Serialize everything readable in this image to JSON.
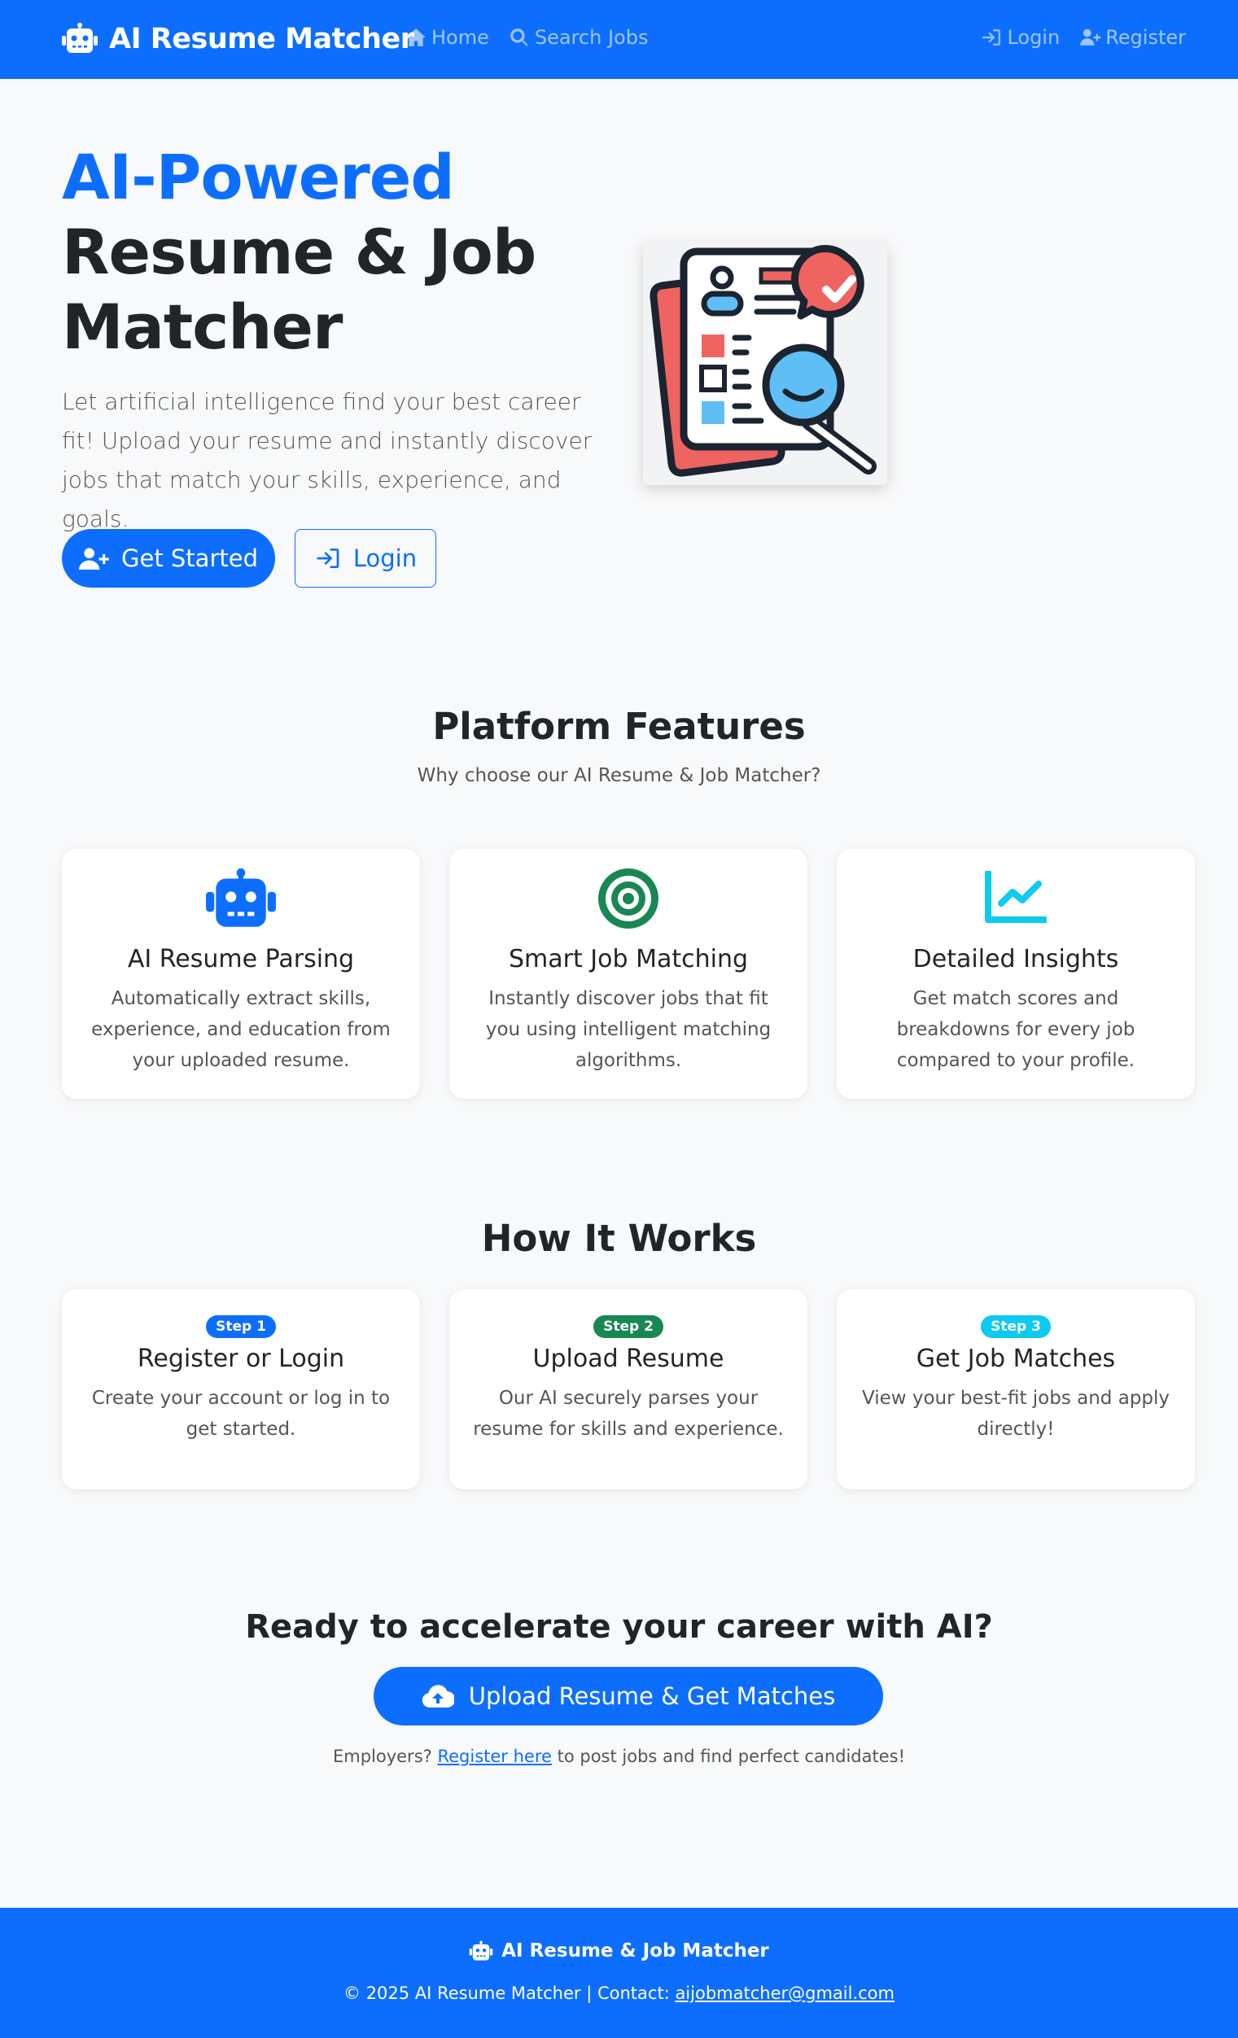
{
  "navbar": {
    "brand": "AI Resume Matcher",
    "links_left": [
      {
        "label": "Home",
        "icon": "home-icon"
      },
      {
        "label": "Search Jobs",
        "icon": "search-icon"
      }
    ],
    "links_right": [
      {
        "label": "Login",
        "icon": "login-icon"
      },
      {
        "label": "Register",
        "icon": "user-plus-icon"
      }
    ]
  },
  "hero": {
    "title_accent": "AI-Powered",
    "title_main": "Resume & Job Matcher",
    "lead": "Let artificial intelligence find your best career fit! Upload your resume and instantly discover jobs that match your skills, experience, and goals.",
    "get_started_label": "Get Started",
    "login_label": "Login",
    "image_icon": "resume-search-icon"
  },
  "features": {
    "title": "Platform Features",
    "subtitle": "Why choose our AI Resume & Job Matcher?",
    "items": [
      {
        "icon": "robot-icon",
        "title": "AI Resume Parsing",
        "text": "Automatically extract skills, experience, and education from your uploaded resume.",
        "color": "#0d6efd"
      },
      {
        "icon": "target-icon",
        "title": "Smart Job Matching",
        "text": "Instantly discover jobs that fit you using intelligent matching algorithms.",
        "color": "#198754"
      },
      {
        "icon": "chart-line-icon",
        "title": "Detailed Insights",
        "text": "Get match scores and breakdowns for every job compared to your profile.",
        "color": "#0dcaf0"
      }
    ]
  },
  "how": {
    "title": "How It Works",
    "steps": [
      {
        "badge": "Step 1",
        "title": "Register or Login",
        "text": "Create your account or log in to get started.",
        "color": "#0d6efd"
      },
      {
        "badge": "Step 2",
        "title": "Upload Resume",
        "text": "Our AI securely parses your resume for skills and experience.",
        "color": "#198754"
      },
      {
        "badge": "Step 3",
        "title": "Get Job Matches",
        "text": "View your best-fit jobs and apply directly!",
        "color": "#0dcaf0"
      }
    ]
  },
  "cta": {
    "title": "Ready to accelerate your career with AI?",
    "button_label": "Upload Resume & Get Matches",
    "note_prefix": "Employers?",
    "note_link": "Register here",
    "note_suffix": "to post jobs and find perfect candidates!"
  },
  "footer": {
    "brand": "AI Resume & Job Matcher",
    "copy_prefix": "© 2025 AI Resume Matcher | Contact:",
    "email": "aijobmatcher@gmail.com"
  },
  "colors": {
    "primary": "#0d6efd",
    "success": "#198754",
    "info": "#0dcaf0",
    "background": "#f8f9fa"
  }
}
